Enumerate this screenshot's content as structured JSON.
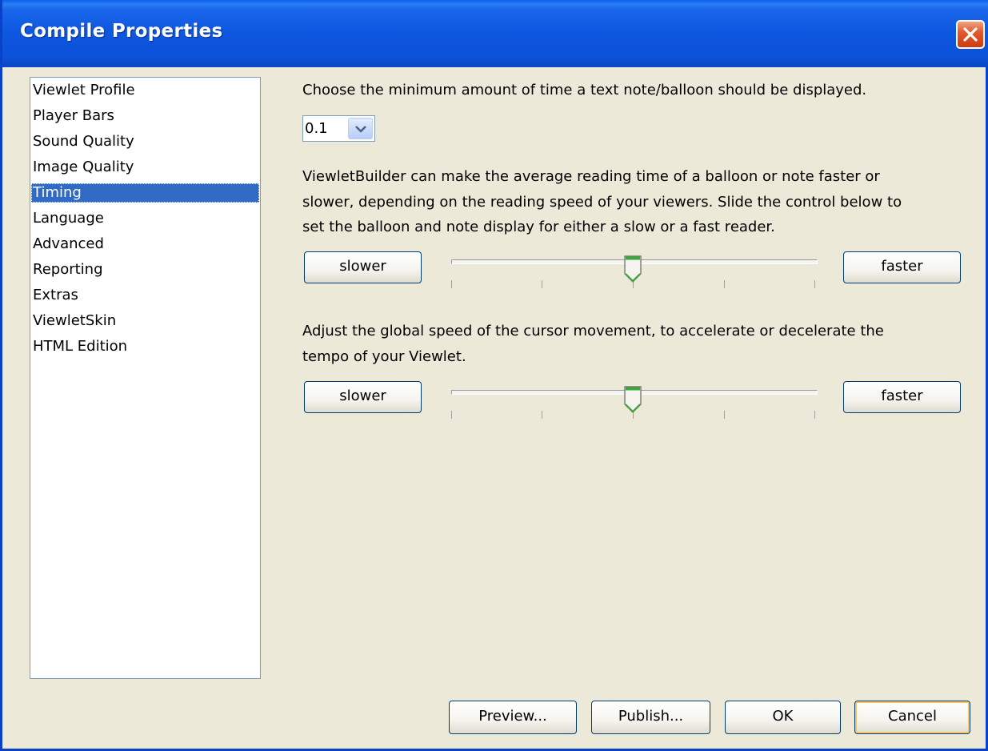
{
  "window": {
    "title": "Compile Properties"
  },
  "nav": {
    "items": [
      {
        "label": "Viewlet Profile"
      },
      {
        "label": "Player Bars"
      },
      {
        "label": "Sound Quality"
      },
      {
        "label": "Image Quality"
      },
      {
        "label": "Timing"
      },
      {
        "label": "Language"
      },
      {
        "label": "Advanced"
      },
      {
        "label": "Reporting"
      },
      {
        "label": "Extras"
      },
      {
        "label": "ViewletSkin"
      },
      {
        "label": "HTML Edition"
      }
    ],
    "selected": "Timing"
  },
  "timing": {
    "min_time_label": "Choose the minimum amount of time a text note/balloon should be displayed.",
    "min_time_value": "0.1",
    "reading_desc": [
      "ViewletBuilder can make the average reading time of a balloon or note faster or",
      "slower, depending on the reading speed of your viewers. Slide the control below to",
      "set the balloon and note display for either a slow or a fast reader."
    ],
    "reading_slider": {
      "slower_label": "slower",
      "faster_label": "faster",
      "position": 0.5
    },
    "cursor_desc": [
      "Adjust the global speed of the cursor movement, to accelerate or decelerate the",
      "tempo of your Viewlet."
    ],
    "cursor_slider": {
      "slower_label": "slower",
      "faster_label": "faster",
      "position": 0.5
    }
  },
  "footer": {
    "preview_label": "Preview...",
    "publish_label": "Publish...",
    "ok_label": "OK",
    "cancel_label": "Cancel"
  },
  "icons": {
    "close": "close-icon",
    "dropdown": "chevron-down-icon"
  },
  "colors": {
    "titlebar": "#0c52d8",
    "selection": "#316AC5",
    "slider_thumb_accent": "#3aa83a"
  }
}
